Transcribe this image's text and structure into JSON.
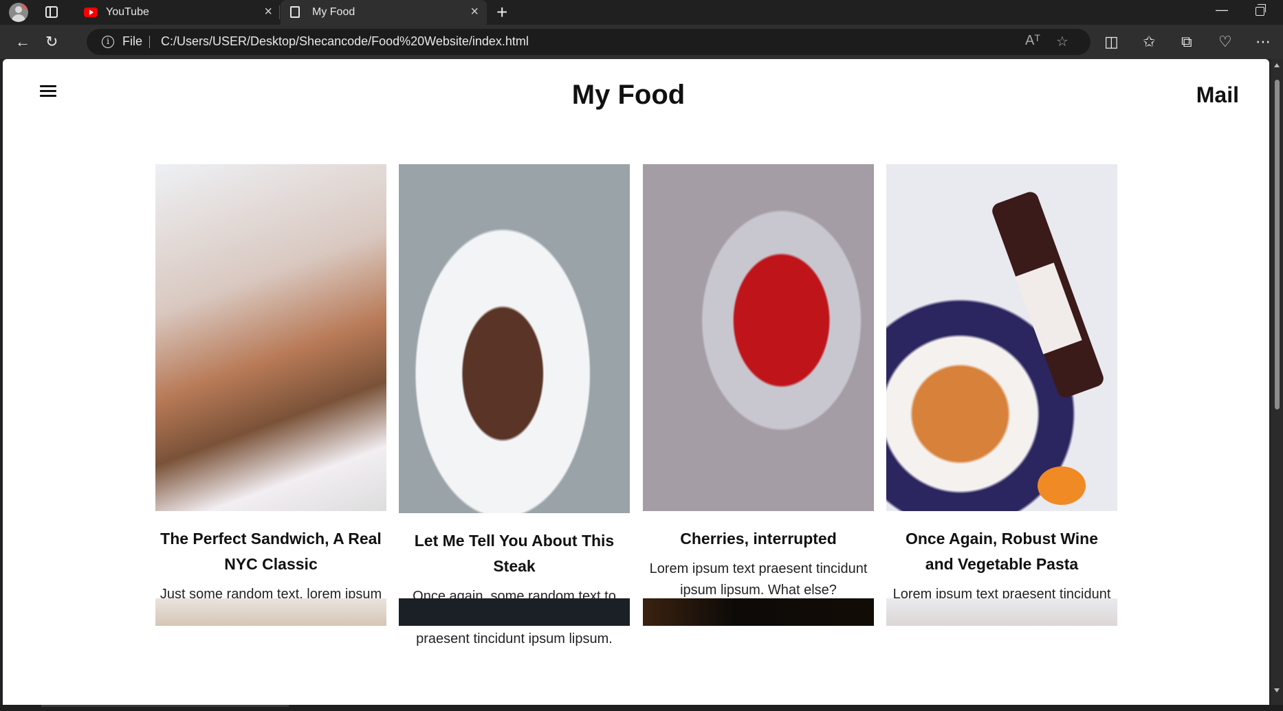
{
  "browser": {
    "tabs": [
      {
        "label": "YouTube",
        "icon": "youtube-icon",
        "active": false
      },
      {
        "label": "My Food",
        "icon": "document-icon",
        "active": true
      }
    ],
    "address": {
      "scheme": "File",
      "url": "C:/Users/USER/Desktop/Shecancode/Food%20Website/index.html"
    },
    "read_aloud_glyph": "Aᵀ"
  },
  "page": {
    "title": "My Food",
    "mail_link": "Mail",
    "cards": [
      {
        "title": "The Perfect Sandwich, A Real NYC Classic",
        "text": "Just some random text, lorem ipsum text praesent tincidunt ipsum lipsum.",
        "image": "sandwich"
      },
      {
        "title": "Let Me Tell You About This Steak",
        "text": "Once again, some random text to lorem lorem lorem lorem ipsum text praesent tincidunt ipsum lipsum.",
        "image": "steak"
      },
      {
        "title": "Cherries, interrupted",
        "text": "Lorem ipsum text praesent tincidunt ipsum lipsum. What else?",
        "image": "cherries"
      },
      {
        "title": "Once Again, Robust Wine and Vegetable Pasta",
        "text": "Lorem ipsum text praesent tincidunt ipsum lipsum.",
        "image": "pasta"
      }
    ]
  },
  "colors": {
    "chrome_dark": "#202020",
    "toolbar": "#2f2f2f",
    "page_bg": "#ffffff",
    "text": "#111111"
  }
}
